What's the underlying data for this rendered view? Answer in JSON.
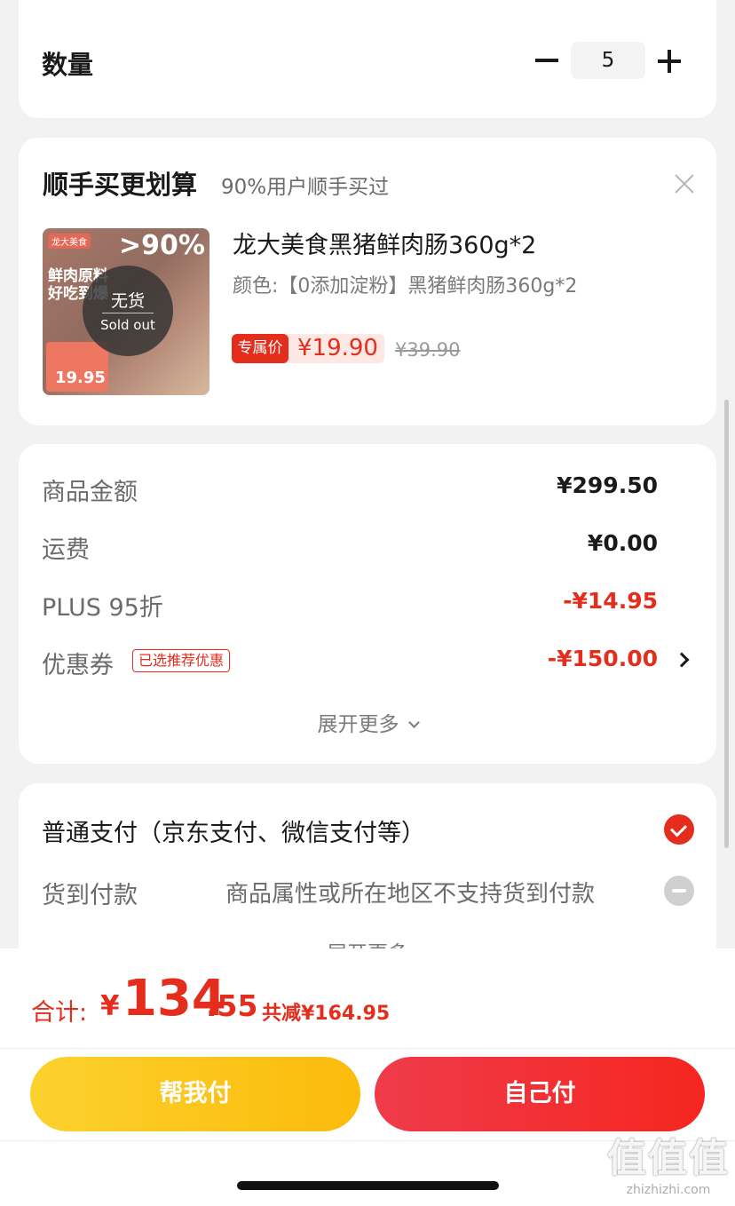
{
  "quantity": {
    "label": "数量",
    "value": "5"
  },
  "addon": {
    "title": "顺手买更划算",
    "subtitle": "90%用户顺手买过",
    "product": {
      "name": "龙大美食黑猪鲜肉肠360g*2",
      "spec": "颜色:【0添加淀粉】黑猪鲜肉肠360g*2",
      "price_tag": "专属价",
      "price": "¥19.90",
      "original_price": "¥39.90",
      "image_brand": "龙大美食",
      "image_pct": ">90%",
      "image_headline_1": "鲜肉原料",
      "image_headline_2": "好吃到爆",
      "image_price": "19.95",
      "soldout_cn": "无货",
      "soldout_en": "Sold out"
    }
  },
  "summary": {
    "rows": [
      {
        "label": "商品金额",
        "value": "¥299.50"
      },
      {
        "label": "运费",
        "value": "¥0.00"
      },
      {
        "label": "PLUS 95折",
        "value": "-¥14.95"
      },
      {
        "label": "优惠券",
        "value": "-¥150.00",
        "badge": "已选推荐优惠"
      }
    ],
    "expand_label": "展开更多"
  },
  "payment": {
    "option1": "普通支付（京东支付、微信支付等）",
    "option2_label": "货到付款",
    "option2_note": "商品属性或所在地区不支持货到付款",
    "expand_label": "展开更多"
  },
  "footer": {
    "total_label": "合计:",
    "currency": "¥",
    "total_int": "134",
    "total_dec": ".55",
    "saved": "共减¥164.95",
    "btn_help": "帮我付",
    "btn_self": "自己付"
  },
  "watermark": {
    "big": "值值值",
    "small": "zhizhizhi.com"
  },
  "colors": {
    "accent_red": "#e42d1c",
    "yellow_button": "#fbbb0b",
    "red_button": "#f5261f"
  }
}
